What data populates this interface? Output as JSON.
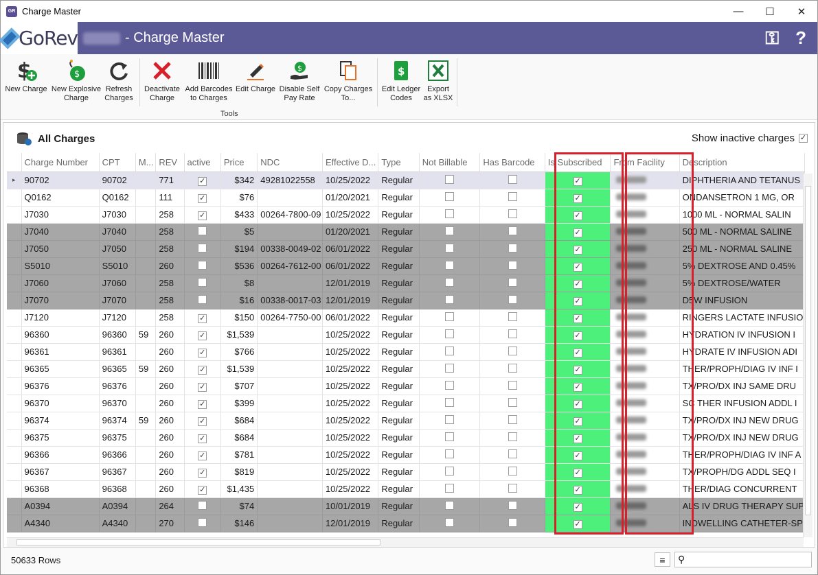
{
  "window": {
    "title": "Charge Master",
    "minimize": "—",
    "maximize": "☐",
    "close": "✕"
  },
  "banner": {
    "logo_text": "GoRev",
    "title": "- Charge Master",
    "keys_icon": "⚿",
    "help_icon": "?"
  },
  "toolbar": {
    "group_label": "Tools",
    "tools": [
      {
        "label": "New Charge"
      },
      {
        "label": "New Explosive Charge"
      },
      {
        "label": "Refresh Charges"
      },
      {
        "label": "Deactivate Charge"
      },
      {
        "label": "Add Barcodes to Charges"
      },
      {
        "label": "Edit Charge"
      },
      {
        "label": "Disable Self Pay Rate"
      },
      {
        "label": "Copy Charges To..."
      },
      {
        "label": "Edit Ledger Codes"
      },
      {
        "label": "Export as XLSX"
      }
    ]
  },
  "content": {
    "title": "All Charges",
    "show_inactive_label": "Show inactive charges"
  },
  "grid": {
    "columns": [
      "Charge Number",
      "CPT",
      "M...",
      "REV",
      "active",
      "Price",
      "NDC",
      "Effective D...",
      "Type",
      "Not Billable",
      "Has Barcode",
      "Is Subscribed",
      "From Facility",
      "Description"
    ],
    "rows": [
      {
        "charge": "90702",
        "cpt": "90702",
        "mod": "",
        "rev": "771",
        "active": true,
        "price": "$342",
        "ndc": "49281022558",
        "eff": "10/25/2022",
        "type": "Regular",
        "desc": "DIPHTHERIA AND TETANUS",
        "inactive": false,
        "selected": true
      },
      {
        "charge": "Q0162",
        "cpt": "Q0162",
        "mod": "",
        "rev": "111",
        "active": true,
        "price": "$76",
        "ndc": "",
        "eff": "01/20/2021",
        "type": "Regular",
        "desc": "ONDANSETRON 1 MG, OR",
        "inactive": false
      },
      {
        "charge": "J7030",
        "cpt": "J7030",
        "mod": "",
        "rev": "258",
        "active": true,
        "price": "$433",
        "ndc": "00264-7800-09",
        "eff": "10/25/2022",
        "type": "Regular",
        "desc": "1000 ML - NORMAL SALIN",
        "inactive": false
      },
      {
        "charge": "J7040",
        "cpt": "J7040",
        "mod": "",
        "rev": "258",
        "active": false,
        "price": "$5",
        "ndc": "",
        "eff": "01/20/2021",
        "type": "Regular",
        "desc": "500 ML - NORMAL SALINE",
        "inactive": true
      },
      {
        "charge": "J7050",
        "cpt": "J7050",
        "mod": "",
        "rev": "258",
        "active": false,
        "price": "$194",
        "ndc": "00338-0049-02",
        "eff": "06/01/2022",
        "type": "Regular",
        "desc": "250 ML - NORMAL SALINE",
        "inactive": true
      },
      {
        "charge": "S5010",
        "cpt": "S5010",
        "mod": "",
        "rev": "260",
        "active": false,
        "price": "$536",
        "ndc": "00264-7612-00",
        "eff": "06/01/2022",
        "type": "Regular",
        "desc": "5% DEXTROSE AND 0.45%",
        "inactive": true
      },
      {
        "charge": "J7060",
        "cpt": "J7060",
        "mod": "",
        "rev": "258",
        "active": false,
        "price": "$8",
        "ndc": "",
        "eff": "12/01/2019",
        "type": "Regular",
        "desc": "5% DEXTROSE/WATER",
        "inactive": true
      },
      {
        "charge": "J7070",
        "cpt": "J7070",
        "mod": "",
        "rev": "258",
        "active": false,
        "price": "$16",
        "ndc": "00338-0017-03",
        "eff": "12/01/2019",
        "type": "Regular",
        "desc": "D5W INFUSION",
        "inactive": true
      },
      {
        "charge": "J7120",
        "cpt": "J7120",
        "mod": "",
        "rev": "258",
        "active": true,
        "price": "$150",
        "ndc": "00264-7750-00",
        "eff": "06/01/2022",
        "type": "Regular",
        "desc": "RINGERS LACTATE INFUSIO",
        "inactive": false
      },
      {
        "charge": "96360",
        "cpt": "96360",
        "mod": "59",
        "rev": "260",
        "active": true,
        "price": "$1,539",
        "ndc": "",
        "eff": "10/25/2022",
        "type": "Regular",
        "desc": "HYDRATION IV INFUSION I",
        "inactive": false
      },
      {
        "charge": "96361",
        "cpt": "96361",
        "mod": "",
        "rev": "260",
        "active": true,
        "price": "$766",
        "ndc": "",
        "eff": "10/25/2022",
        "type": "Regular",
        "desc": "HYDRATE IV INFUSION ADI",
        "inactive": false
      },
      {
        "charge": "96365",
        "cpt": "96365",
        "mod": "59",
        "rev": "260",
        "active": true,
        "price": "$1,539",
        "ndc": "",
        "eff": "10/25/2022",
        "type": "Regular",
        "desc": "THER/PROPH/DIAG IV INF I",
        "inactive": false
      },
      {
        "charge": "96376",
        "cpt": "96376",
        "mod": "",
        "rev": "260",
        "active": true,
        "price": "$707",
        "ndc": "",
        "eff": "10/25/2022",
        "type": "Regular",
        "desc": "TX/PRO/DX INJ SAME DRU",
        "inactive": false
      },
      {
        "charge": "96370",
        "cpt": "96370",
        "mod": "",
        "rev": "260",
        "active": true,
        "price": "$399",
        "ndc": "",
        "eff": "10/25/2022",
        "type": "Regular",
        "desc": "SC THER INFUSION ADDL I",
        "inactive": false
      },
      {
        "charge": "96374",
        "cpt": "96374",
        "mod": "59",
        "rev": "260",
        "active": true,
        "price": "$684",
        "ndc": "",
        "eff": "10/25/2022",
        "type": "Regular",
        "desc": "TX/PRO/DX INJ NEW DRUG",
        "inactive": false
      },
      {
        "charge": "96375",
        "cpt": "96375",
        "mod": "",
        "rev": "260",
        "active": true,
        "price": "$684",
        "ndc": "",
        "eff": "10/25/2022",
        "type": "Regular",
        "desc": "TX/PRO/DX INJ NEW DRUG",
        "inactive": false
      },
      {
        "charge": "96366",
        "cpt": "96366",
        "mod": "",
        "rev": "260",
        "active": true,
        "price": "$781",
        "ndc": "",
        "eff": "10/25/2022",
        "type": "Regular",
        "desc": "THER/PROPH/DIAG IV INF A",
        "inactive": false
      },
      {
        "charge": "96367",
        "cpt": "96367",
        "mod": "",
        "rev": "260",
        "active": true,
        "price": "$819",
        "ndc": "",
        "eff": "10/25/2022",
        "type": "Regular",
        "desc": "TX/PROPH/DG ADDL SEQ I",
        "inactive": false
      },
      {
        "charge": "96368",
        "cpt": "96368",
        "mod": "",
        "rev": "260",
        "active": true,
        "price": "$1,435",
        "ndc": "",
        "eff": "10/25/2022",
        "type": "Regular",
        "desc": "THER/DIAG CONCURRENT",
        "inactive": false
      },
      {
        "charge": "A0394",
        "cpt": "A0394",
        "mod": "",
        "rev": "264",
        "active": false,
        "price": "$74",
        "ndc": "",
        "eff": "10/01/2019",
        "type": "Regular",
        "desc": "ALS IV DRUG THERAPY SUP",
        "inactive": true
      },
      {
        "charge": "A4340",
        "cpt": "A4340",
        "mod": "",
        "rev": "270",
        "active": false,
        "price": "$146",
        "ndc": "",
        "eff": "12/01/2019",
        "type": "Regular",
        "desc": "INDWELLING CATHETER-SP",
        "inactive": true
      }
    ]
  },
  "status": {
    "row_count": "50633 Rows",
    "menu_icon": "≡",
    "search_icon": "⚲",
    "search_placeholder": ""
  },
  "colors": {
    "banner": "#5c5a96",
    "subscribed": "#4cf07a",
    "highlight": "#d8202a",
    "inactive_row": "#a7a7a7"
  }
}
